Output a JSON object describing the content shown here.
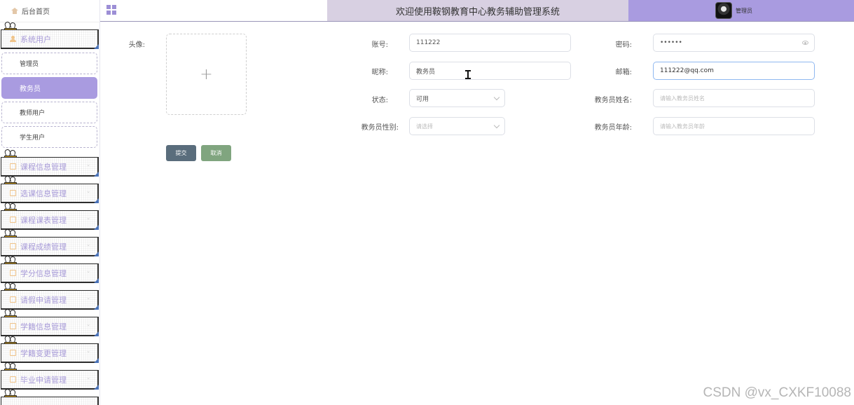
{
  "sidebar": {
    "home_label": "后台首页",
    "system_users": {
      "label": "系统用户",
      "items": [
        {
          "label": "管理员"
        },
        {
          "label": "教务员",
          "active": true
        },
        {
          "label": "教师用户"
        },
        {
          "label": "学生用户"
        }
      ]
    },
    "menus": [
      {
        "label": "课程信息管理"
      },
      {
        "label": "选课信息管理"
      },
      {
        "label": "课程课表管理"
      },
      {
        "label": "课程成绩管理"
      },
      {
        "label": "学分信息管理"
      },
      {
        "label": "请假申请管理"
      },
      {
        "label": "学籍信息管理"
      },
      {
        "label": "学籍变更管理"
      },
      {
        "label": "毕业申请管理"
      }
    ]
  },
  "header": {
    "title": "欢迎使用鞍钢教育中心教务辅助管理系统",
    "user_label": "管理员"
  },
  "form": {
    "avatar_label": "头像:",
    "upload_plus": "+",
    "account_label": "账号:",
    "account_value": "111222",
    "password_label": "密码:",
    "password_value": "••••••",
    "nickname_label": "昵称:",
    "nickname_value": "教务员",
    "email_label": "邮箱:",
    "email_value": "111222@qq.com",
    "status_label": "状态:",
    "status_value": "可用",
    "name_label": "教务员姓名:",
    "name_placeholder": "请输入教务员姓名",
    "gender_label": "教务员性别:",
    "gender_placeholder": "请选择",
    "age_label": "教务员年龄:",
    "age_placeholder": "请输入教务员年龄",
    "submit_label": "提交",
    "cancel_label": "取消"
  },
  "colors": {
    "accent": "#a99be0",
    "title_bg": "#d8d0e2",
    "submit_bg": "#5a6d7c",
    "cancel_bg": "#80a57f"
  },
  "watermark": "CSDN @vx_CXKF10088"
}
